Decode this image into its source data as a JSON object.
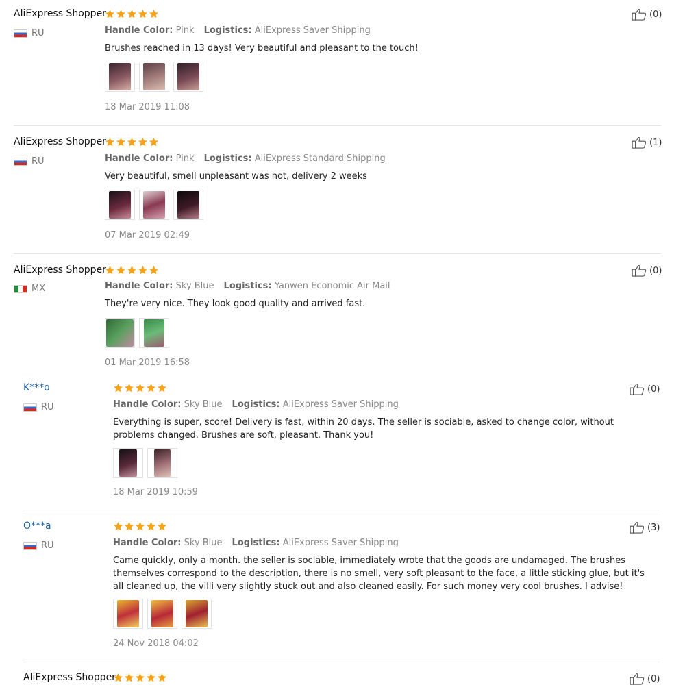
{
  "labels": {
    "handle_color": "Handle Color:",
    "logistics": "Logistics:"
  },
  "icons": {
    "star": "star-icon",
    "thumb": "thumbs-up-icon",
    "flag_ru": "flag-ru-icon",
    "flag_mx": "flag-mx-icon"
  },
  "colors": {
    "star": "#f7a21b",
    "link": "#1b5fa8"
  },
  "reviews": [
    {
      "name": "AliExpress Shopper",
      "rating": 5,
      "country": "RU",
      "handle_color": "Pink",
      "logistics": "AliExpress Saver Shipping",
      "text": "Brushes reached in 13 days! Very beautiful and pleasant to the touch!",
      "date": "18 Mar 2019 11:08",
      "likes": "(0)"
    },
    {
      "name": "AliExpress Shopper",
      "rating": 5,
      "country": "RU",
      "handle_color": "Pink",
      "logistics": "AliExpress Standard Shipping",
      "text": "Very beautiful, smell unpleasant was not, delivery 2 weeks",
      "date": "07 Mar 2019 02:49",
      "likes": "(1)"
    },
    {
      "name": "AliExpress Shopper",
      "rating": 5,
      "country": "MX",
      "handle_color": "Sky Blue",
      "logistics": "Yanwen Economic Air Mail",
      "text": "They're very nice. They look good quality and arrived fast.",
      "date": "01 Mar 2019 16:58",
      "likes": "(0)"
    },
    {
      "name": "K***o",
      "rating": 5,
      "country": "RU",
      "handle_color": "Sky Blue",
      "logistics": "AliExpress Saver Shipping",
      "text": "Everything is super, score! Delivery is fast, within 20 days. The seller is sociable, asked to change color, without problems changed. Brushes are soft, pleasant. Thank you!",
      "date": "18 Mar 2019 10:59",
      "likes": "(0)"
    },
    {
      "name": "O***a",
      "rating": 5,
      "country": "RU",
      "handle_color": "Sky Blue",
      "logistics": "AliExpress Saver Shipping",
      "text": "Came quickly, only a month. the seller is sociable, immediately wrote that the goods are undamaged. The brushes themselves correspond to the description, there is no smell, very soft pleasant to the face, a little sticking glue, but it's all cleaned up, the villi very slightly stuck out and also cleaned easily. For such money very cool brushes. I advise!",
      "date": "24 Nov 2018 04:02",
      "likes": "(3)"
    },
    {
      "name": "AliExpress Shopper",
      "rating": 5,
      "likes": "(0)"
    }
  ]
}
